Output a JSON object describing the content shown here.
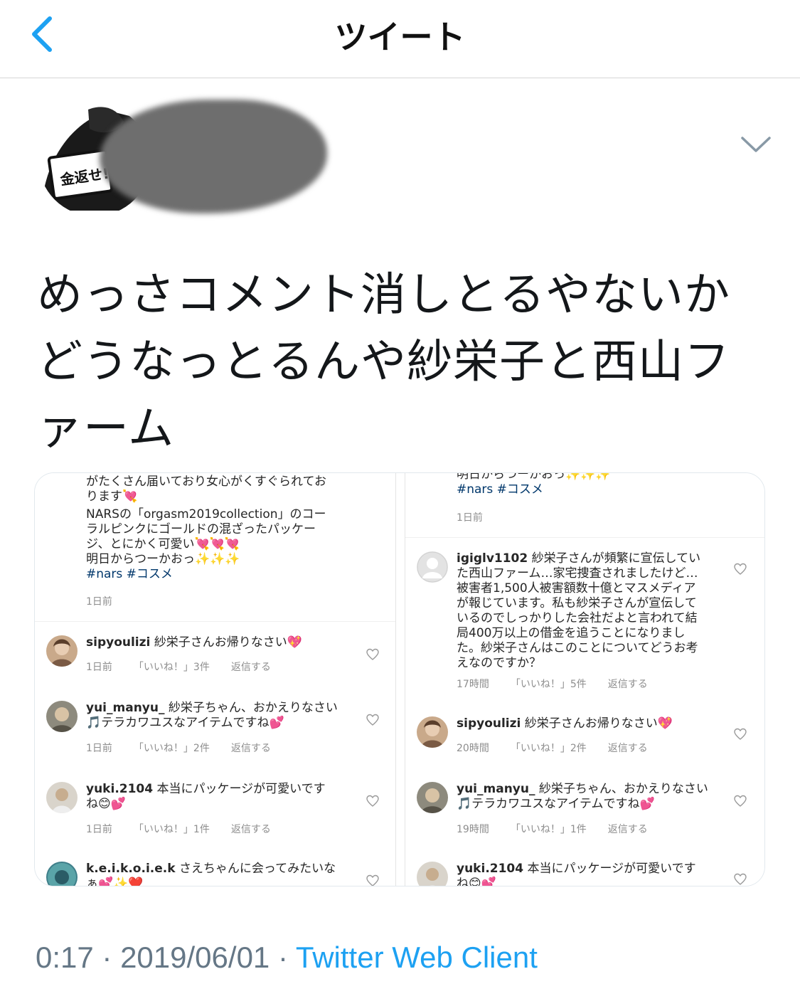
{
  "header": {
    "title": "ツイート"
  },
  "author": {
    "avatar_text": "金返せ!"
  },
  "tweet": {
    "lines": [
      "めっさコメント消しとるやないか",
      "どうなっとるんや紗栄子と西山フ",
      "ァーム"
    ]
  },
  "footer": {
    "time": "0:17",
    "date": "2019/06/01",
    "separator": " · ",
    "client": "Twitter Web Client"
  },
  "media": {
    "left": {
      "caption_lines": [
        "がたくさん届いており女心がくすぐられてお",
        "ります💘",
        "NARSの「orgasm2019collection」のコー",
        "ラルピンクにゴールドの混ざったパッケー",
        "ジ、とにかく可愛い💘💘💘",
        "明日からつーかおっ✨✨✨",
        "#nars #コスメ"
      ],
      "caption_time": "1日前",
      "comments": [
        {
          "user": "sipyoulizi",
          "text_lines": [
            "紗栄子さんお帰りなさい💖"
          ],
          "time": "1日前",
          "likes": "「いいね！」3件",
          "reply": "返信する"
        },
        {
          "user": "yui_manyu_",
          "text_lines": [
            "紗栄子ちゃん、おかえりなさい",
            "🎵テラカワユスなアイテムですね💕"
          ],
          "time": "1日前",
          "likes": "「いいね！」2件",
          "reply": "返信する"
        },
        {
          "user": "yuki.2104",
          "text_lines": [
            "本当にパッケージが可愛いです",
            "ね😊💕"
          ],
          "time": "1日前",
          "likes": "「いいね！」1件",
          "reply": "返信する"
        },
        {
          "user": "k.e.i.k.o.i.e.k",
          "text_lines": [
            "さえちゃんに会ってみたいな",
            "ぁ💕✨❤️"
          ],
          "time": "",
          "likes": "",
          "reply": ""
        }
      ]
    },
    "right": {
      "caption_lines": [
        "明日からつーかおっ✨✨✨",
        "#nars #コスメ"
      ],
      "caption_time": "1日前",
      "comments": [
        {
          "user": "igiglv1102",
          "text_lines": [
            "紗栄子さんが頻繁に宣伝してい",
            "た西山ファーム…家宅捜査されましたけど…",
            "被害者1,500人被害額数十億とマスメディア",
            "が報じています。私も紗栄子さんが宣伝して",
            "いるのでしっかりした会社だよと言われて結",
            "局400万以上の借金を追うことになりまし",
            "た。紗栄子さんはこのことについてどうお考",
            "えなのですか？"
          ],
          "time": "17時間",
          "likes": "「いいね！」5件",
          "reply": "返信する"
        },
        {
          "user": "sipyoulizi",
          "text_lines": [
            "紗栄子さんお帰りなさい💖"
          ],
          "time": "20時間",
          "likes": "「いいね！」2件",
          "reply": "返信する"
        },
        {
          "user": "yui_manyu_",
          "text_lines": [
            "紗栄子ちゃん、おかえりなさい",
            "🎵テラカワユスなアイテムですね💕"
          ],
          "time": "19時間",
          "likes": "「いいね！」1件",
          "reply": "返信する"
        },
        {
          "user": "yuki.2104",
          "text_lines": [
            "本当にパッケージが可愛いです",
            "ね😊💕"
          ],
          "time": "",
          "likes": "",
          "reply": ""
        }
      ]
    }
  },
  "colors": {
    "accent": "#1da1f2",
    "meta": "#657786",
    "ig_link": "#00376b"
  }
}
